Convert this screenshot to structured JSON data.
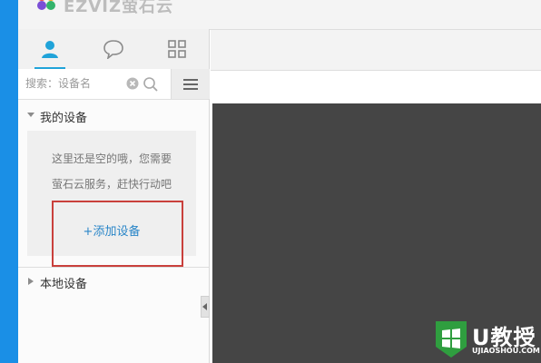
{
  "app": {
    "brand": "EZVIZ萤石云"
  },
  "tabs": [
    {
      "icon": "person-icon",
      "active": true
    },
    {
      "icon": "chat-bubble-icon",
      "active": false
    },
    {
      "icon": "grid-icon",
      "active": false
    }
  ],
  "search": {
    "placeholder": "搜索：设备名",
    "value": ""
  },
  "groups": {
    "my_devices": {
      "label": "我的设备",
      "expanded": true,
      "empty_line1": "这里还是空的哦，您需要",
      "empty_line2": "萤石云服务，赶快行动吧",
      "add_label": "+添加设备"
    },
    "local_devices": {
      "label": "本地设备",
      "expanded": false
    }
  },
  "watermark": {
    "title": "U教授",
    "url": "UJIAOSHOU.COM"
  },
  "colors": {
    "accent": "#20a3d9",
    "link": "#2a86c8",
    "highlight": "#c9403c",
    "video_bg": "#454545",
    "side_strip": "#1a8fe6"
  }
}
